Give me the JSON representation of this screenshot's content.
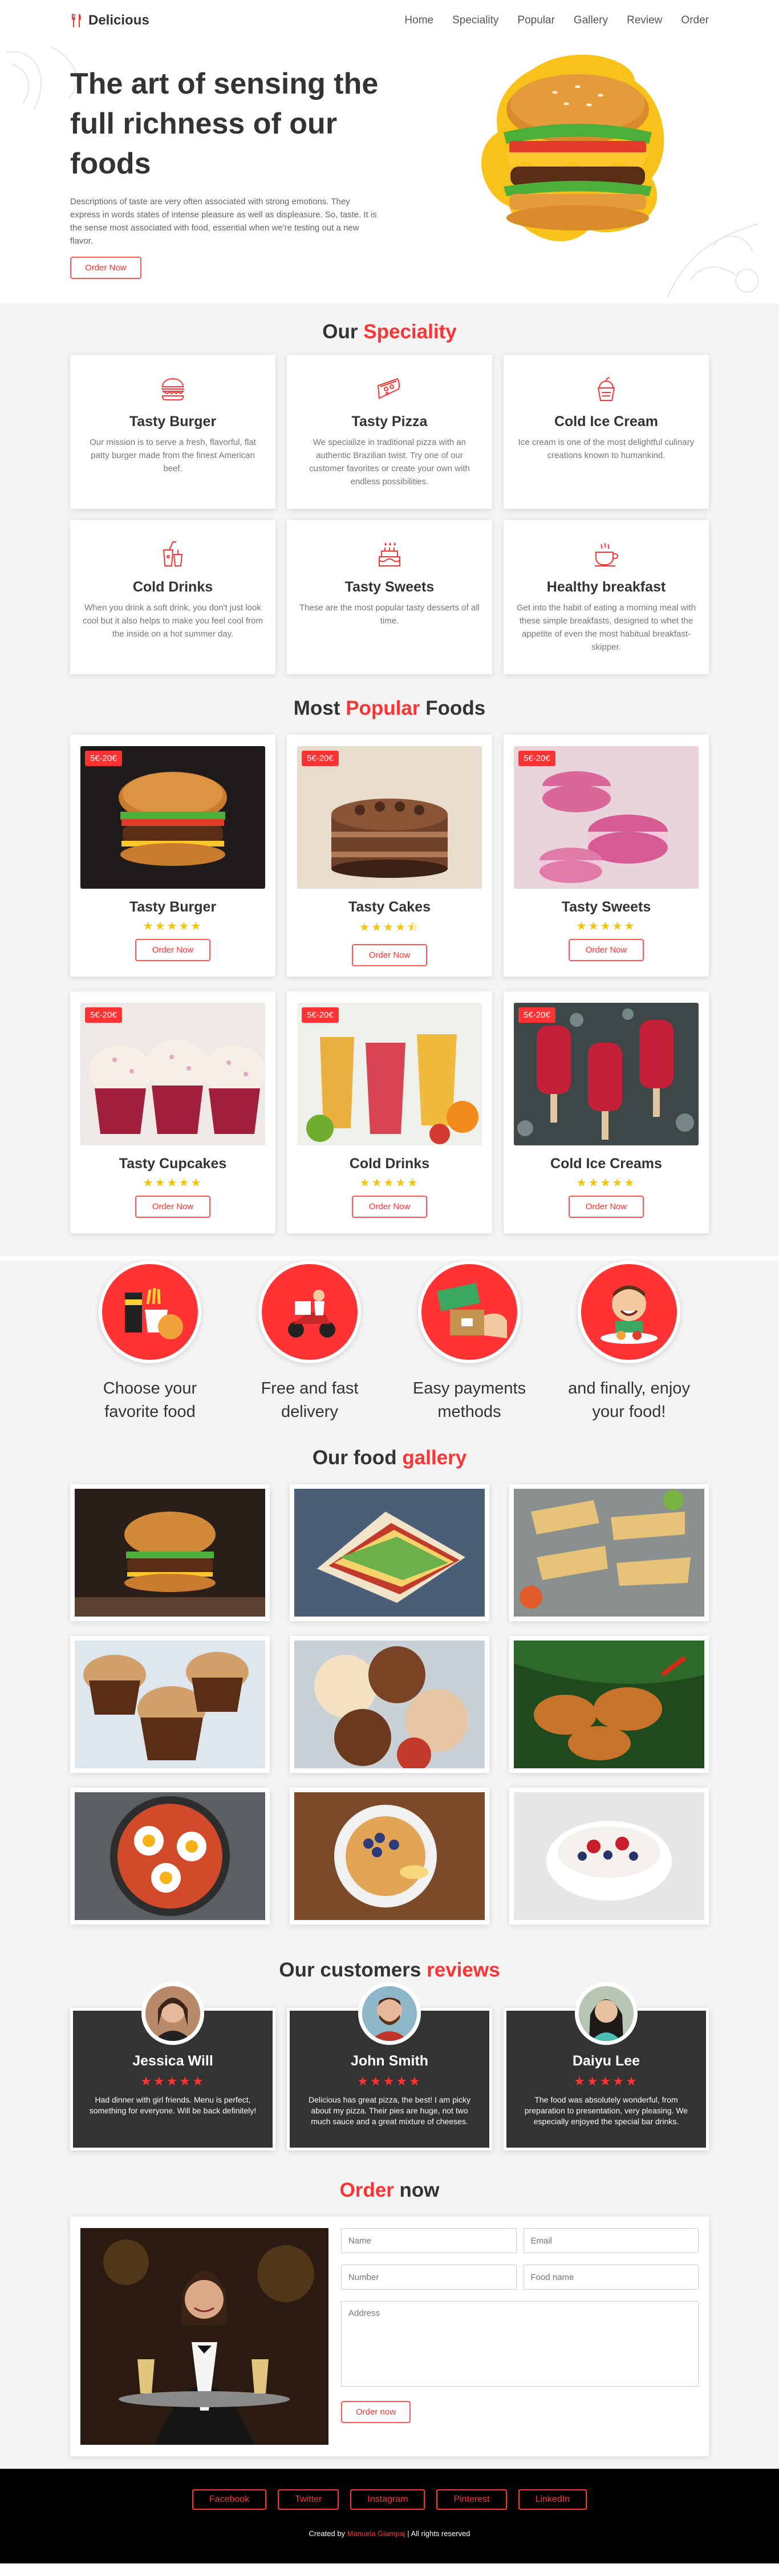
{
  "header": {
    "logo": "Delicious",
    "nav": [
      "Home",
      "Speciality",
      "Popular",
      "Gallery",
      "Review",
      "Order"
    ]
  },
  "hero": {
    "title": "The art of sensing the full richness of our foods",
    "description": "Descriptions of taste are very often associated with strong emotions. They express in words states of intense pleasure as well as displeasure. So, taste. It is the sense most associated with food, essential when we're testing out a new flavor.",
    "button": "Order Now"
  },
  "speciality": {
    "title_plain": "Our",
    "title_accent": "Speciality",
    "items": [
      {
        "name": "Tasty Burger",
        "desc": "Our mission is to serve a fresh, flavorful, flat patty burger made from the finest American beef.",
        "icon": "burger-icon"
      },
      {
        "name": "Tasty Pizza",
        "desc": "We specialize in traditional pizza with an authentic Brazilian twist. Try one of our customer favorites or create your own with endless possibilities.",
        "icon": "pizza-icon"
      },
      {
        "name": "Cold Ice Cream",
        "desc": "Ice cream is one of the most delightful culinary creations known to humankind.",
        "icon": "ice-cream-icon"
      },
      {
        "name": "Cold Drinks",
        "desc": "When you drink a soft drink, you don't just look cool but it also helps to make you feel cool from the inside on a hot summer day.",
        "icon": "drinks-icon"
      },
      {
        "name": "Tasty Sweets",
        "desc": "These are the most popular tasty desserts of all time.",
        "icon": "cake-icon"
      },
      {
        "name": "Healthy breakfast",
        "desc": "Get into the habit of eating a morning meal with these simple breakfasts, designed to whet the appetite of even the most habitual breakfast-skipper.",
        "icon": "coffee-cup-icon"
      }
    ]
  },
  "popular": {
    "title_plain_1": "Most",
    "title_accent": "Popular",
    "title_plain_2": "Foods",
    "items": [
      {
        "name": "Tasty Burger",
        "price": "5€-20€",
        "stars": "★★★★★",
        "button": "Order Now"
      },
      {
        "name": "Tasty Cakes",
        "price": "5€-20€",
        "stars": "★★★★⯪",
        "button": "Order Now"
      },
      {
        "name": "Tasty Sweets",
        "price": "5€-20€",
        "stars": "★★★★★",
        "button": "Order Now"
      },
      {
        "name": "Tasty Cupcakes",
        "price": "5€-20€",
        "stars": "★★★★★",
        "button": "Order Now"
      },
      {
        "name": "Cold Drinks",
        "price": "5€-20€",
        "stars": "★★★★★",
        "button": "Order Now"
      },
      {
        "name": "Cold Ice Creams",
        "price": "5€-20€",
        "stars": "★★★★★",
        "button": "Order Now"
      }
    ]
  },
  "steps": [
    {
      "line1": "Choose your",
      "line2": "favorite food"
    },
    {
      "line1": "Free and fast",
      "line2": "delivery"
    },
    {
      "line1": "Easy payments",
      "line2": "methods"
    },
    {
      "line1": "and finally, enjoy",
      "line2": "your food!"
    }
  ],
  "gallery": {
    "title_plain": "Our food",
    "title_accent": "gallery"
  },
  "reviews": {
    "title_plain": "Our customers",
    "title_accent": "reviews",
    "items": [
      {
        "name": "Jessica Will",
        "stars": "★★★★★",
        "text": "Had dinner with girl friends. Menu is perfect, something for everyone. Will be back definitely!"
      },
      {
        "name": "John Smith",
        "stars": "★★★★★",
        "text": "Delicious has great pizza, the best! I am picky about my pizza. Their pies are huge, not two much sauce and a great mixture of cheeses."
      },
      {
        "name": "Daiyu Lee",
        "stars": "★★★★★",
        "text": "The food was absolutely wonderful, from preparation to presentation, very pleasing. We especially enjoyed the special bar drinks."
      }
    ]
  },
  "order": {
    "title_accent": "Order",
    "title_plain": "now",
    "placeholders": {
      "name": "Name",
      "email": "Email",
      "number": "Number",
      "food": "Food name",
      "address": "Address"
    },
    "button": "Order now"
  },
  "footer": {
    "socials": [
      "Facebook",
      "Twitter",
      "Instagram",
      "Pinterest",
      "LinkedIn"
    ],
    "credit_prefix": "Created by",
    "credit_author": "Manuela Giampaj",
    "credit_suffix": "| All rights reserved"
  },
  "colors": {
    "accent": "#ff3333",
    "dark_card": "#333333",
    "star_gold": "#f5c400"
  }
}
